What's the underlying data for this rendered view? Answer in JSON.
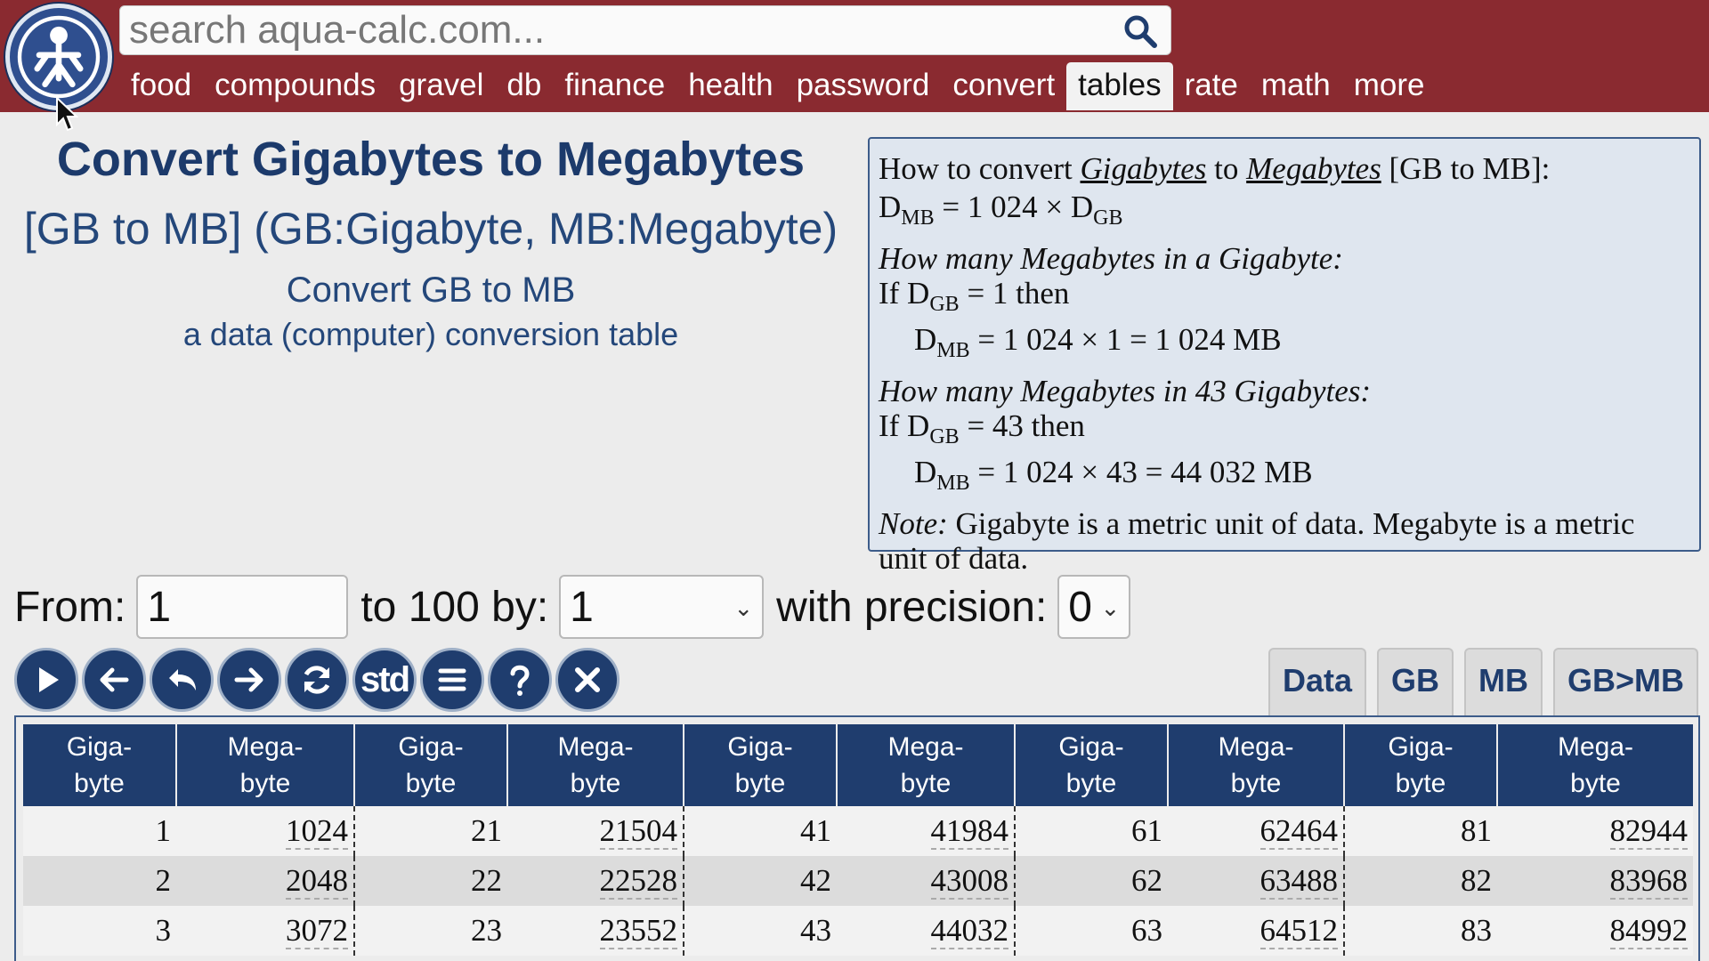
{
  "search": {
    "placeholder": "search aqua-calc.com..."
  },
  "nav": {
    "items": [
      "food",
      "compounds",
      "gravel",
      "db",
      "finance",
      "health",
      "password",
      "convert",
      "tables",
      "rate",
      "math",
      "more"
    ],
    "active": "tables"
  },
  "titles": {
    "main": "Convert Gigabytes to Megabytes",
    "units": "[GB to MB] (GB:Gigabyte, MB:Megabyte)",
    "sub": "Convert GB to MB",
    "desc": "a data (computer) conversion table"
  },
  "formula": {
    "how_prefix": "How to convert",
    "from_unit": "Gigabytes",
    "to_word": "to",
    "to_unit": "Megabytes",
    "how_suffix": "[GB to MB]:",
    "formula_prefix": "D",
    "mb_sub": "MB",
    "gb_sub": "GB",
    "formula_mid": " = 1 024 × D",
    "q1": "How many Megabytes in a Gigabyte:",
    "if_word": "If D",
    "q1_cond": " = 1  then",
    "q1_result": " = 1 024 × 1 = 1 024 MB",
    "q2": "How many Megabytes in 43 Gigabytes:",
    "q2_cond": " = 43  then",
    "q2_result": " = 1 024 × 43 = 44 032 MB",
    "note_label": "Note:",
    "note_text": " Gigabyte is a metric unit of data.  Megabyte is a metric unit of data."
  },
  "controls": {
    "from_label": "From:",
    "from_value": "1",
    "to_label": "to 100 by:",
    "by_value": "1",
    "precision_label": "with precision:",
    "precision_value": "0"
  },
  "toolbar": {
    "std_label": "std"
  },
  "tabs": [
    "Data",
    "GB",
    "MB",
    "GB>MB"
  ],
  "table": {
    "header_top": [
      "Giga-",
      "Mega-"
    ],
    "header_bottom": [
      "byte",
      "byte"
    ],
    "rows": [
      [
        "1",
        "1024",
        "21",
        "21504",
        "41",
        "41984",
        "61",
        "62464",
        "81",
        "82944"
      ],
      [
        "2",
        "2048",
        "22",
        "22528",
        "42",
        "43008",
        "62",
        "63488",
        "82",
        "83968"
      ],
      [
        "3",
        "3072",
        "23",
        "23552",
        "43",
        "44032",
        "63",
        "64512",
        "83",
        "84992"
      ]
    ]
  },
  "colors": {
    "header_bg": "#8a2a30",
    "accent": "#1f3d6e",
    "formula_bg": "#dfe6ef"
  }
}
